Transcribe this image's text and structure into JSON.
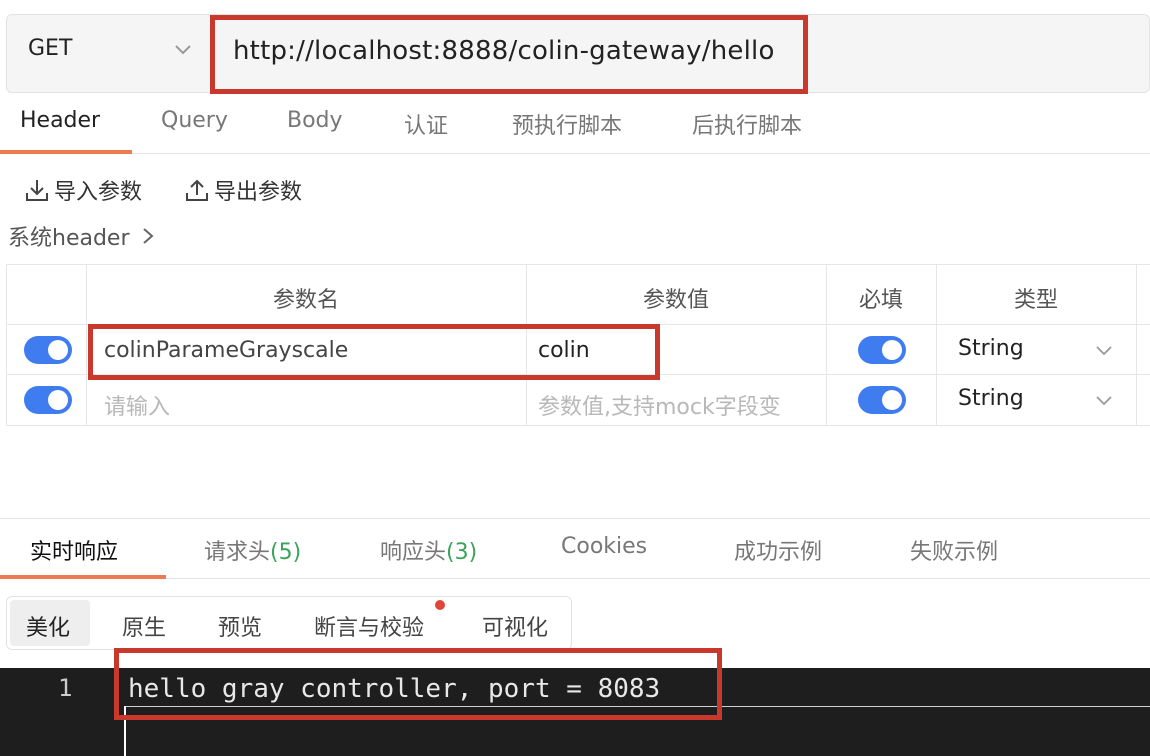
{
  "request": {
    "method": "GET",
    "url": "http://localhost:8888/colin-gateway/hello"
  },
  "request_tabs": [
    "Header",
    "Query",
    "Body",
    "认证",
    "预执行脚本",
    "后执行脚本"
  ],
  "tools": {
    "import_label": "导入参数",
    "export_label": "导出参数"
  },
  "system_header_label": "系统header",
  "params_table": {
    "columns": [
      "参数名",
      "参数值",
      "必填",
      "类型"
    ],
    "rows": [
      {
        "enabled": true,
        "name": "colinParameGrayscale",
        "value": "colin",
        "required": true,
        "type": "String"
      },
      {
        "enabled": true,
        "name_placeholder": "请输入",
        "value_placeholder": "参数值,支持mock字段变",
        "required": true,
        "type": "String"
      }
    ]
  },
  "response_tabs": {
    "realtime": "实时响应",
    "req_headers": "请求头",
    "req_headers_count": "(5)",
    "resp_headers": "响应头",
    "resp_headers_count": "(3)",
    "cookies": "Cookies",
    "success_example": "成功示例",
    "fail_example": "失败示例"
  },
  "view_modes": [
    "美化",
    "原生",
    "预览",
    "断言与校验",
    "可视化"
  ],
  "editor": {
    "line_number": "1",
    "line_text": "hello gray controller, port = 8083"
  },
  "colors": {
    "accent": "#ee7a52",
    "toggle": "#3f7cf0",
    "highlight_box": "#c8382d",
    "count_green": "#3aa35a"
  }
}
